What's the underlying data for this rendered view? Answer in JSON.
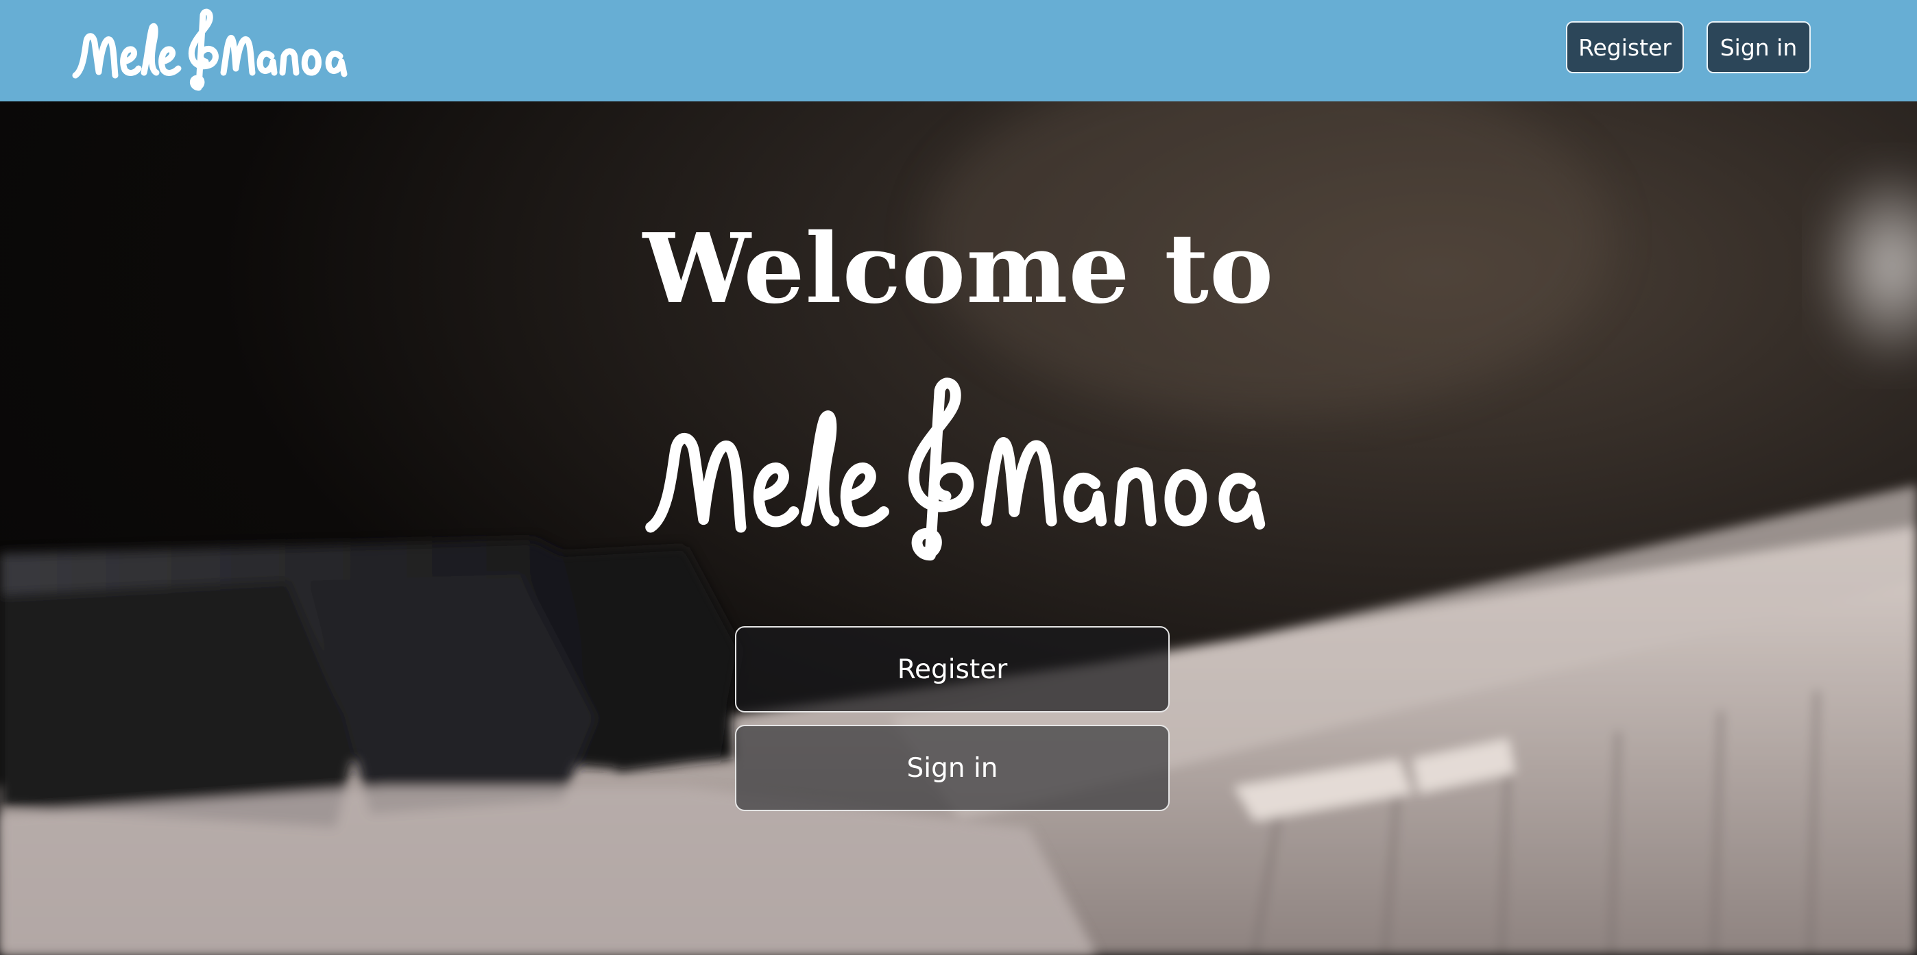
{
  "navbar": {
    "brand_logo_text": "Mele&Manoa",
    "register_label": "Register",
    "signin_label": "Sign in",
    "background_color": "#67aed4",
    "button_color": "#2c4659"
  },
  "hero": {
    "welcome_text": "Welcome to",
    "logo_text": "Mele&Manoa",
    "register_label": "Register",
    "signin_label": "Sign in",
    "background_image": "piano-keys-photo"
  }
}
